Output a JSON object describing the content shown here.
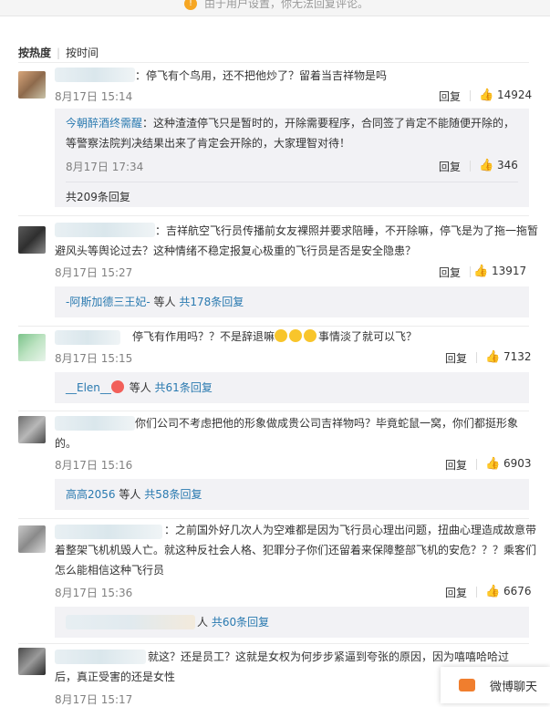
{
  "notice": {
    "text": "由于用户设置，你无法回复评论。"
  },
  "sort": {
    "by_hot": "按热度",
    "by_time": "按时间"
  },
  "comments": [
    {
      "text": "：停飞有个鸟用，还不把他炒了？留着当吉祥物是吗",
      "time": "8月17日 15:14",
      "reply": "回复",
      "likes": "14924",
      "sub": {
        "name": "今朝醉酒终需醒",
        "text": "：这种渣渣停飞只是暂时的，开除需要程序，合同签了肯定不能随便开除的，等警察法院判决结果出来了肯定会开除的，大家理智对待！",
        "time": "8月17日 17:34",
        "reply": "回复",
        "likes": "346"
      },
      "more": "共209条回复"
    },
    {
      "text": "：吉祥航空飞行员传播前女友裸照并要求陪睡，不开除嘛，停飞是为了拖一拖暂避风头等舆论过去？这种情绪不稳定报复心极重的飞行员是否是安全隐患？",
      "time": "8月17日 15:27",
      "reply": "回复",
      "likes": "13917",
      "more_name": "-阿斯加德三王妃-",
      "more_mid": " 等人 ",
      "more": "共178条回复"
    },
    {
      "text": "停飞有作用吗？？不是辞退嘛",
      "text2": "事情淡了就可以飞？",
      "time": "8月17日 15:15",
      "reply": "回复",
      "likes": "7132",
      "more_name": "__Elen__",
      "more_mid": " 等人 ",
      "more": "共61条回复"
    },
    {
      "text": "你们公司不考虑把他的形象做成贵公司吉祥物吗？毕竟蛇鼠一窝，你们都挺形象的。",
      "time": "8月17日 15:16",
      "reply": "回复",
      "likes": "6903",
      "more_name": "高高2056",
      "more_mid": " 等人 ",
      "more": "共58条回复"
    },
    {
      "text": "：之前国外好几次人为空难都是因为飞行员心理出问题，扭曲心理造成故意带着整架飞机机毁人亡。就这种反社会人格、犯罪分子你们还留着来保障整部飞机的安危？？？乘客们怎么能相信这种飞行员",
      "time": "8月17日 15:36",
      "reply": "回复",
      "likes": "6676",
      "more_mid": "人 ",
      "more": "共60条回复"
    },
    {
      "text": "就这？还是员工？这就是女权为何步步紧逼到夸张的原因，因为嘻嘻哈哈过后，真正受害的还是女性",
      "time": "8月17日 15:17"
    }
  ],
  "chat": {
    "label": "微博聊天"
  }
}
